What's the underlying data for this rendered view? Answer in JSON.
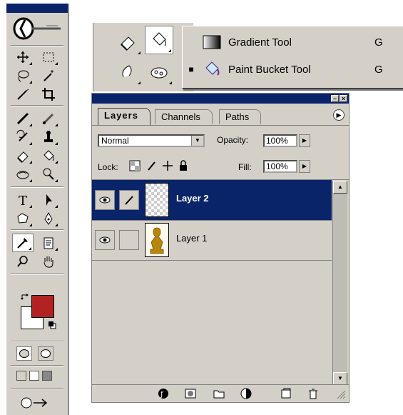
{
  "toolbox": {
    "tools": [
      "move-tool",
      "marquee-tool",
      "lasso-tool",
      "magic-wand-tool",
      "crop-tool",
      "slice-tool",
      "healing-brush-tool",
      "brush-tool",
      "clone-stamp-tool",
      "history-brush-tool",
      "eraser-tool",
      "gradient-tool",
      "blur-tool",
      "dodge-tool",
      "type-tool",
      "path-selection-tool",
      "shape-tool",
      "pen-tool",
      "notes-tool",
      "eyedropper-tool",
      "hand-tool",
      "zoom-tool"
    ],
    "foreground_color": "#b22222",
    "background_color": "#ffffff"
  },
  "flyout": {
    "items": [
      {
        "label": "Gradient Tool",
        "shortcut": "G",
        "selected": false
      },
      {
        "label": "Paint Bucket Tool",
        "shortcut": "G",
        "selected": true
      }
    ],
    "selected_marker": "■"
  },
  "layers_panel": {
    "tabs": [
      "Layers",
      "Channels",
      "Paths"
    ],
    "active_tab": "Layers",
    "blend_mode": "Normal",
    "opacity_label": "Opacity:",
    "opacity_value": "100%",
    "lock_label": "Lock:",
    "fill_label": "Fill:",
    "fill_value": "100%",
    "layers": [
      {
        "name": "Layer 2",
        "selected": true,
        "visible": true,
        "thumbnail": "transparent"
      },
      {
        "name": "Layer 1",
        "selected": false,
        "visible": true,
        "thumbnail": "statue"
      }
    ]
  },
  "colors": {
    "title_bar": "#0a246a",
    "chrome": "#d4d0c8",
    "selection": "#0a246a"
  }
}
